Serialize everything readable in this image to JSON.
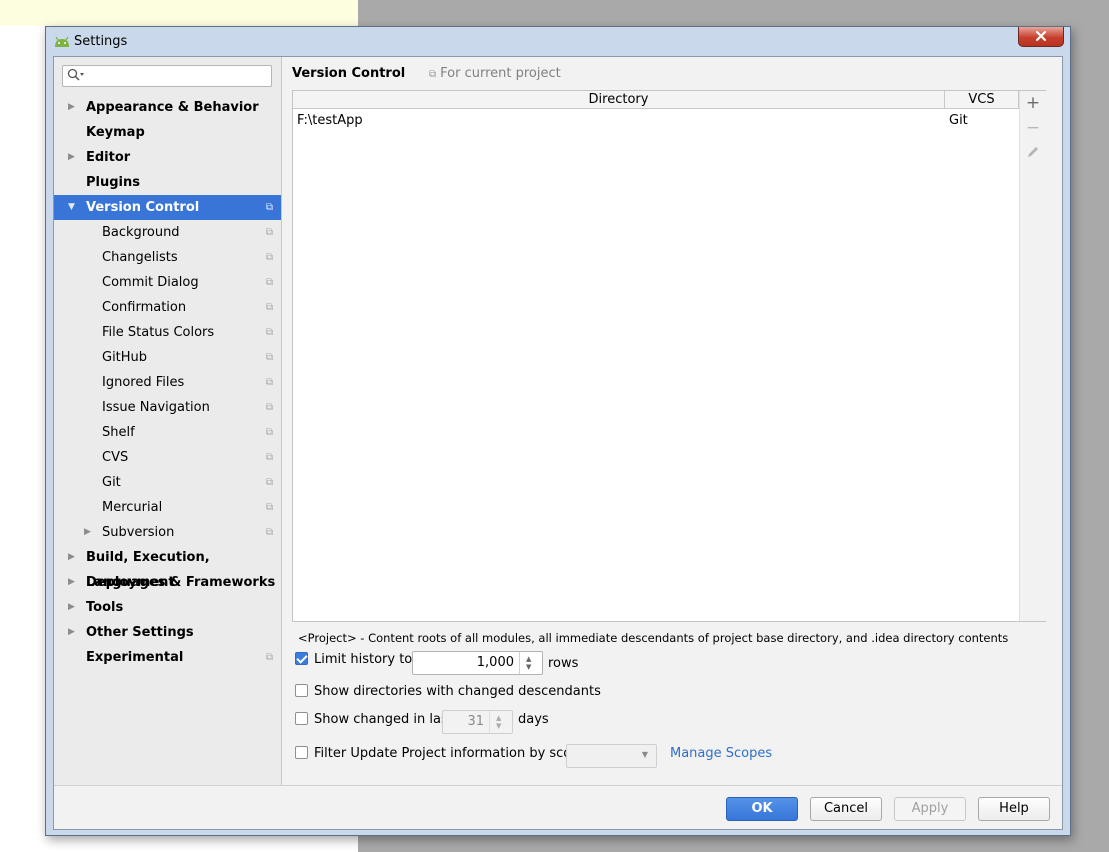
{
  "window": {
    "title": "Settings"
  },
  "sidebar": {
    "search_placeholder": "",
    "items": [
      {
        "label": "Appearance & Behavior",
        "expandable": true,
        "level": 0
      },
      {
        "label": "Keymap",
        "expandable": false,
        "level": 0
      },
      {
        "label": "Editor",
        "expandable": true,
        "level": 0
      },
      {
        "label": "Plugins",
        "expandable": false,
        "level": 0
      },
      {
        "label": "Version Control",
        "expandable": true,
        "expanded": true,
        "selected": true,
        "level": 0,
        "project": true
      },
      {
        "label": "Background",
        "level": 1,
        "project": true
      },
      {
        "label": "Changelists",
        "level": 1,
        "project": true
      },
      {
        "label": "Commit Dialog",
        "level": 1,
        "project": true
      },
      {
        "label": "Confirmation",
        "level": 1,
        "project": true
      },
      {
        "label": "File Status Colors",
        "level": 1,
        "project": true
      },
      {
        "label": "GitHub",
        "level": 1,
        "project": true
      },
      {
        "label": "Ignored Files",
        "level": 1,
        "project": true
      },
      {
        "label": "Issue Navigation",
        "level": 1,
        "project": true
      },
      {
        "label": "Shelf",
        "level": 1,
        "project": true
      },
      {
        "label": "CVS",
        "level": 1,
        "project": true
      },
      {
        "label": "Git",
        "level": 1,
        "project": true
      },
      {
        "label": "Mercurial",
        "level": 1,
        "project": true
      },
      {
        "label": "Subversion",
        "level": 1,
        "expandable": true,
        "project": true
      },
      {
        "label": "Build, Execution, Deployment",
        "expandable": true,
        "level": 0
      },
      {
        "label": "Languages & Frameworks",
        "expandable": true,
        "level": 0
      },
      {
        "label": "Tools",
        "expandable": true,
        "level": 0
      },
      {
        "label": "Other Settings",
        "expandable": true,
        "level": 0
      },
      {
        "label": "Experimental",
        "expandable": false,
        "level": 0,
        "project": true
      }
    ]
  },
  "content": {
    "title": "Version Control",
    "scope_label": "For current project",
    "table": {
      "columns": [
        "Directory",
        "VCS"
      ],
      "rows": [
        {
          "directory": "F:\\testApp",
          "vcs": "Git"
        }
      ]
    },
    "note": "<Project> - Content roots of all modules, all immediate descendants of project base directory, and .idea directory contents",
    "limit_history": {
      "checked": true,
      "label": "Limit history to:",
      "value": "1,000",
      "suffix": "rows"
    },
    "show_dirs": {
      "checked": false,
      "label": "Show directories with changed descendants"
    },
    "show_changed": {
      "checked": false,
      "label": "Show changed in last",
      "value": "31",
      "suffix": "days"
    },
    "filter_update": {
      "checked": false,
      "label": "Filter Update Project information by scope",
      "selected": ""
    },
    "manage_scopes": "Manage Scopes"
  },
  "buttons": {
    "ok": "OK",
    "cancel": "Cancel",
    "apply": "Apply",
    "help": "Help"
  },
  "colors": {
    "accent": "#3875d6",
    "link": "#2f6fcb",
    "close": "#c7402d"
  }
}
